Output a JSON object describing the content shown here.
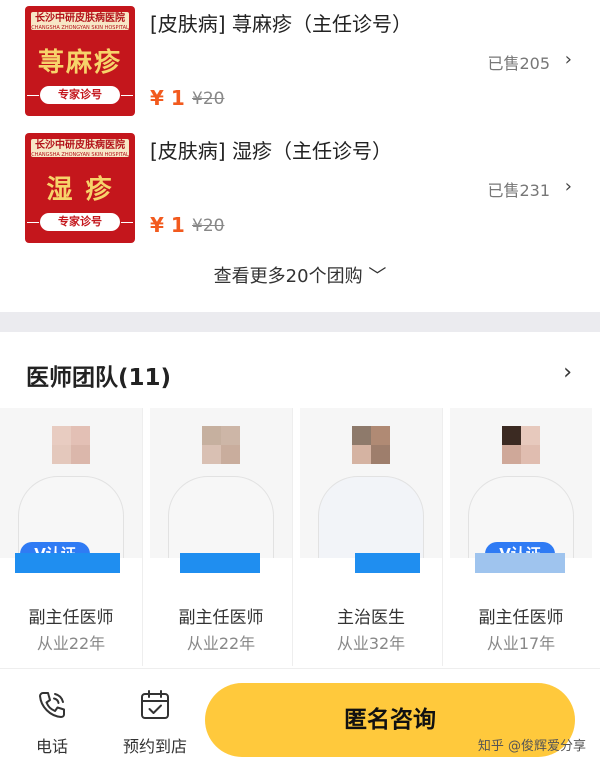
{
  "deals": [
    {
      "hospital": "长沙中研皮肤病医院",
      "hospital_en": "CHANGSHA ZHONGYAN SKIN HOSPITAL",
      "disease": "荨麻疹",
      "badge": "专家诊号",
      "title": "[皮肤病] 荨麻疹（主任诊号）",
      "price": "¥ 1",
      "original_price": "¥20",
      "sold": "已售205"
    },
    {
      "hospital": "长沙中研皮肤病医院",
      "hospital_en": "CHANGSHA ZHONGYAN SKIN HOSPITAL",
      "disease": "湿 疹",
      "badge": "专家诊号",
      "title": "[皮肤病] 湿疹（主任诊号）",
      "price": "¥ 1",
      "original_price": "¥20",
      "sold": "已售231"
    }
  ],
  "more_link": "查看更多20个团购",
  "doctor_team": {
    "title": "医师团队(11)",
    "doctors": [
      {
        "role": "副主任医师",
        "experience": "从业22年",
        "verified": "V认证"
      },
      {
        "role": "副主任医师",
        "experience": "从业22年",
        "verified": ""
      },
      {
        "role": "主治医生",
        "experience": "从业32年",
        "verified": ""
      },
      {
        "role": "副主任医师",
        "experience": "从业17年",
        "verified": "V认证"
      }
    ]
  },
  "bottom_bar": {
    "phone": "电话",
    "appointment": "预约到店",
    "consult": "匿名咨询"
  },
  "watermark": "知乎 @俊辉爱分享"
}
